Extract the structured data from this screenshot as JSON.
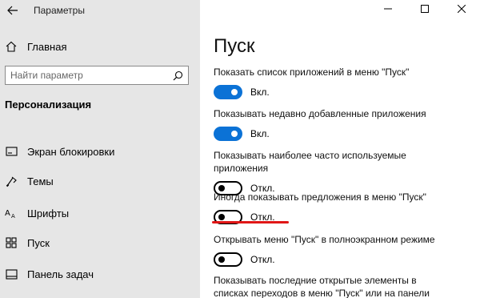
{
  "window": {
    "title": "Параметры"
  },
  "sidebar": {
    "home_label": "Главная",
    "search_placeholder": "Найти параметр",
    "section_title": "Персонализация",
    "items": [
      {
        "label": "Экран блокировки",
        "icon": "lockscreen-icon"
      },
      {
        "label": "Темы",
        "icon": "themes-icon"
      },
      {
        "label": "Шрифты",
        "icon": "fonts-icon"
      },
      {
        "label": "Пуск",
        "icon": "start-icon"
      },
      {
        "label": "Панель задач",
        "icon": "taskbar-icon"
      }
    ]
  },
  "main": {
    "title": "Пуск",
    "settings": [
      {
        "description": "Показать список приложений в меню \"Пуск\"",
        "state": "on",
        "state_label": "Вкл."
      },
      {
        "description": "Показывать недавно добавленные приложения",
        "state": "on",
        "state_label": "Вкл."
      },
      {
        "description": "Показывать наиболее часто используемые приложения",
        "state": "off",
        "state_label": "Откл."
      },
      {
        "description": "Иногда показывать предложения в меню \"Пуск\"",
        "state": "off",
        "state_label": "Откл."
      },
      {
        "description": "Открывать меню \"Пуск\" в полноэкранном режиме",
        "state": "off",
        "state_label": "Откл."
      },
      {
        "description": "Показывать последние открытые элементы в списках переходов в меню \"Пуск\" или на панели задач"
      }
    ]
  },
  "colors": {
    "accent": "#0b72d6",
    "sidebar_bg": "#e6e6e6",
    "highlight_underline": "#e01616"
  }
}
